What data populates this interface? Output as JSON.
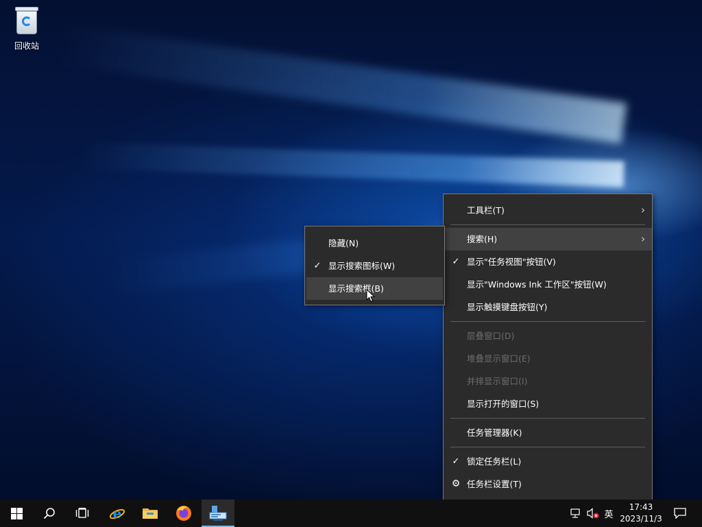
{
  "desktop": {
    "icons": [
      {
        "label": "回收站",
        "icon": "recycle-bin-icon"
      }
    ]
  },
  "context_menu": {
    "items": [
      {
        "label": "工具栏(T)",
        "submenu": true
      },
      {
        "label": "搜索(H)",
        "submenu": true,
        "hover": true
      },
      {
        "label": "显示\"任务视图\"按钮(V)",
        "checked": true
      },
      {
        "label": "显示\"Windows Ink 工作区\"按钮(W)"
      },
      {
        "label": "显示触摸键盘按钮(Y)"
      },
      {
        "label": "层叠窗口(D)",
        "disabled": true
      },
      {
        "label": "堆叠显示窗口(E)",
        "disabled": true
      },
      {
        "label": "并排显示窗口(I)",
        "disabled": true
      },
      {
        "label": "显示打开的窗口(S)"
      },
      {
        "label": "任务管理器(K)"
      },
      {
        "label": "锁定任务栏(L)",
        "checked": true
      },
      {
        "label": "任务栏设置(T)",
        "icon": "gear-icon"
      }
    ]
  },
  "search_submenu": {
    "items": [
      {
        "label": "隐藏(N)"
      },
      {
        "label": "显示搜索图标(W)",
        "checked": true
      },
      {
        "label": "显示搜索框(B)",
        "hover": true
      }
    ]
  },
  "taskbar": {
    "buttons": [
      {
        "name": "start-button",
        "icon": "windows-logo-icon"
      },
      {
        "name": "search-button",
        "icon": "search-icon"
      },
      {
        "name": "task-view-button",
        "icon": "task-view-icon"
      },
      {
        "name": "edge-button",
        "icon": "internet-explorer-icon"
      },
      {
        "name": "file-explorer-button",
        "icon": "folder-icon"
      },
      {
        "name": "firefox-button",
        "icon": "firefox-icon"
      },
      {
        "name": "server-manager-button",
        "icon": "server-manager-icon",
        "active": true
      }
    ],
    "tray": {
      "network_icon": "network-icon",
      "volume_icon": "volume-muted-icon",
      "ime_label": "英",
      "time": "17:43",
      "date": "2023/11/3",
      "notification_icon": "action-center-icon"
    }
  },
  "colors": {
    "menu_bg": "#2b2b2b",
    "menu_hover": "#414141",
    "taskbar_bg": "#101010",
    "active_indicator": "#76b9ed",
    "disabled_text": "#6d6d6d"
  }
}
